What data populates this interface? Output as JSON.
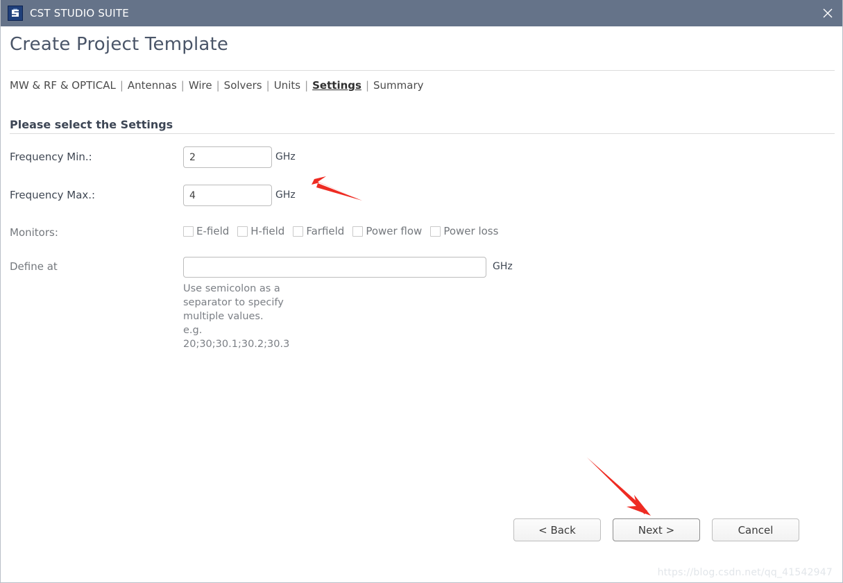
{
  "window": {
    "title": "CST STUDIO SUITE",
    "icon": "cst-logo-icon",
    "close_icon": "close-icon",
    "titlebar_color": "#657389"
  },
  "page": {
    "title": "Create Project Template",
    "section_heading": "Please select the Settings"
  },
  "breadcrumb": {
    "separator": "|",
    "items": [
      {
        "label": "MW & RF & OPTICAL",
        "active": false
      },
      {
        "label": "Antennas",
        "active": false
      },
      {
        "label": "Wire",
        "active": false
      },
      {
        "label": "Solvers",
        "active": false
      },
      {
        "label": "Units",
        "active": false
      },
      {
        "label": "Settings",
        "active": true
      },
      {
        "label": "Summary",
        "active": false
      }
    ]
  },
  "form": {
    "frequency_min": {
      "label": "Frequency Min.:",
      "value": "2",
      "placeholder": "",
      "unit": "GHz"
    },
    "frequency_max": {
      "label": "Frequency Max.:",
      "value": "4",
      "placeholder": "",
      "unit": "GHz"
    },
    "monitors": {
      "label": "Monitors:",
      "items": [
        {
          "label": "E-field",
          "checked": false
        },
        {
          "label": "H-field",
          "checked": false
        },
        {
          "label": "Farfield",
          "checked": false
        },
        {
          "label": "Power flow",
          "checked": false
        },
        {
          "label": "Power loss",
          "checked": false
        }
      ]
    },
    "define_at": {
      "label": "Define at",
      "value": "",
      "placeholder": "",
      "unit": "GHz",
      "hint_line1": "Use semicolon as a separator to specify multiple values.",
      "hint_line2": "e.g. 20;30;30.1;30.2;30.3"
    }
  },
  "footer": {
    "back_label": "< Back",
    "next_label": "Next >",
    "cancel_label": "Cancel"
  },
  "annotations": {
    "arrow_color": "#ee2b22",
    "arrow_1_target": "frequency-fields",
    "arrow_2_target": "next-button"
  },
  "watermark": {
    "text": "https://blog.csdn.net/qq_41542947"
  }
}
